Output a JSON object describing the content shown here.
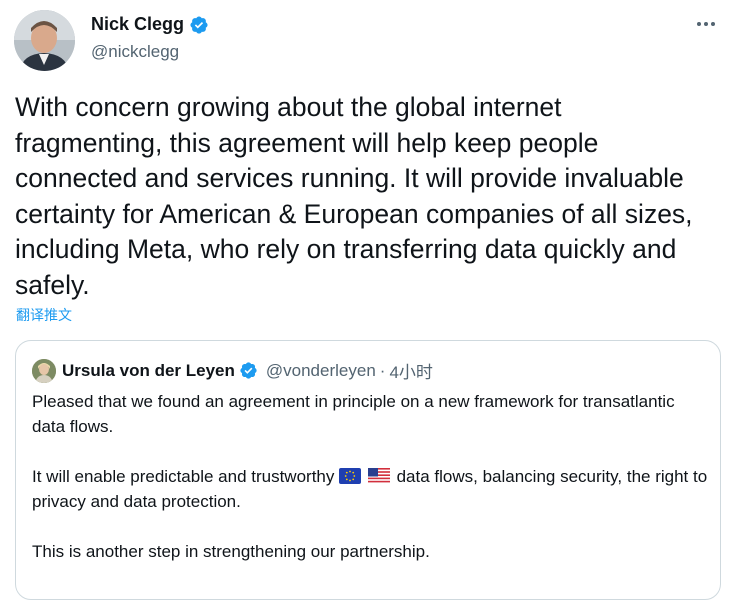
{
  "author": {
    "name": "Nick Clegg",
    "handle": "@nickclegg",
    "verified_icon": "verified-badge-icon",
    "avatar_icon": "profile-photo"
  },
  "more_icon": "more-horizontal-icon",
  "tweet": {
    "text": "With concern growing about the global internet fragmenting, this agreement will help keep people connected and services running. It will provide invaluable certainty for American & European companies of all sizes, including Meta, who rely on transferring data quickly and safely.",
    "translate_label": "翻译推文"
  },
  "quoted": {
    "name": "Ursula von der Leyen",
    "handle": "@vonderleyen",
    "separator": "·",
    "time": "4小时",
    "paragraph1": "Pleased that we found an agreement in principle on a new framework for transatlantic data flows.",
    "paragraph2_after_flags": "data flows, balancing security, the right to privacy and data protection.",
    "paragraph2_before_flags": "It will enable predictable and trustworthy",
    "flags": [
      "eu-flag-icon",
      "us-flag-icon"
    ],
    "paragraph3": "This is another step in strengthening our partnership."
  },
  "colors": {
    "accent": "#1d9bf0",
    "text": "#0f1419",
    "secondary": "#536471",
    "border": "#cfd9de"
  }
}
